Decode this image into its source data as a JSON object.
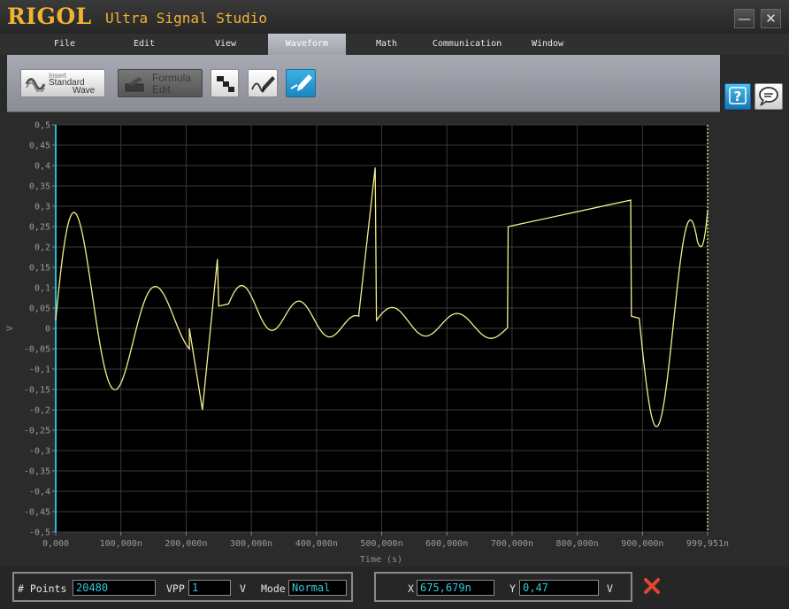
{
  "app": {
    "logo": "RIGOL",
    "title": "Ultra Signal Studio"
  },
  "window_controls": {
    "minimize_glyph": "—",
    "close_glyph": "✕"
  },
  "menu": [
    {
      "label": "File"
    },
    {
      "label": "Edit"
    },
    {
      "label": "View"
    },
    {
      "label": "Waveform",
      "active": true
    },
    {
      "label": "Math"
    },
    {
      "label": "Communication"
    },
    {
      "label": "Window"
    }
  ],
  "toolbar": {
    "insert_standard_wave": {
      "line1": "Insert",
      "line2": "Standard",
      "line3": "Wave"
    },
    "formula_edit": {
      "line1": "Formula",
      "line2": "Edit"
    },
    "help_glyph": "?"
  },
  "chart_data": {
    "type": "line",
    "xlabel": "Time (s)",
    "ylabel": "V",
    "xlim": [
      0,
      999951
    ],
    "ylim": [
      -0.5,
      0.5
    ],
    "x_ticks": [
      "0,000",
      "100,000n",
      "200,000n",
      "300,000n",
      "400,000n",
      "500,000n",
      "600,000n",
      "700,000n",
      "800,000n",
      "900,000n",
      "999,951n"
    ],
    "y_ticks": [
      "0,5",
      "0,45",
      "0,4",
      "0,35",
      "0,3",
      "0,25",
      "0,2",
      "0,15",
      "0,1",
      "0,05",
      "0",
      "-0,05",
      "-0,1",
      "-0,15",
      "-0,2",
      "-0,25",
      "-0,3",
      "-0,35",
      "-0,4",
      "-0,45",
      "-0,5"
    ],
    "grid": true,
    "series": [
      {
        "color": "#f3ef8c"
      }
    ],
    "segments": [
      {
        "kind": "damped",
        "x_start": 0,
        "x_end": 205000,
        "y_start": 0.02,
        "amplitude": 0.34,
        "period": 125000,
        "decay": 0.55
      },
      {
        "kind": "sawtooth_line",
        "points": [
          [
            205000,
            0.0
          ],
          [
            225000,
            -0.2
          ],
          [
            248000,
            0.17
          ],
          [
            250000,
            0.055
          ],
          [
            265000,
            0.06
          ]
        ]
      },
      {
        "kind": "damped",
        "x_start": 265000,
        "x_end": 465000,
        "y_start": 0.06,
        "amplitude": 0.055,
        "period": 88000,
        "decay": 0.2
      },
      {
        "kind": "sawtooth_line",
        "points": [
          [
            465000,
            0.035
          ],
          [
            490000,
            0.395
          ],
          [
            492000,
            0.02
          ]
        ]
      },
      {
        "kind": "damped",
        "x_start": 492000,
        "x_end": 693000,
        "y_start": 0.02,
        "amplitude": 0.035,
        "period": 100000,
        "decay": 0.1
      },
      {
        "kind": "sawtooth_line",
        "points": [
          [
            693000,
            0.015
          ],
          [
            694000,
            0.25
          ],
          [
            882000,
            0.315
          ],
          [
            883000,
            0.03
          ],
          [
            895000,
            0.025
          ]
        ]
      },
      {
        "kind": "damped",
        "x_start": 895000,
        "x_end": 999951,
        "y_start": 0.025,
        "amplitude": -0.26,
        "period": 105000,
        "decay": 0.0,
        "end_y": 0.29
      }
    ]
  },
  "status": {
    "points_label": "# Points",
    "points_value": "20480",
    "vpp_label": "VPP",
    "vpp_value": "1",
    "vpp_unit": "V",
    "mode_label": "Mode",
    "mode_value": "Normal",
    "x_label": "X",
    "x_value": "675,679n",
    "y_label": "Y",
    "y_value": "0,47",
    "y_unit": "V"
  }
}
